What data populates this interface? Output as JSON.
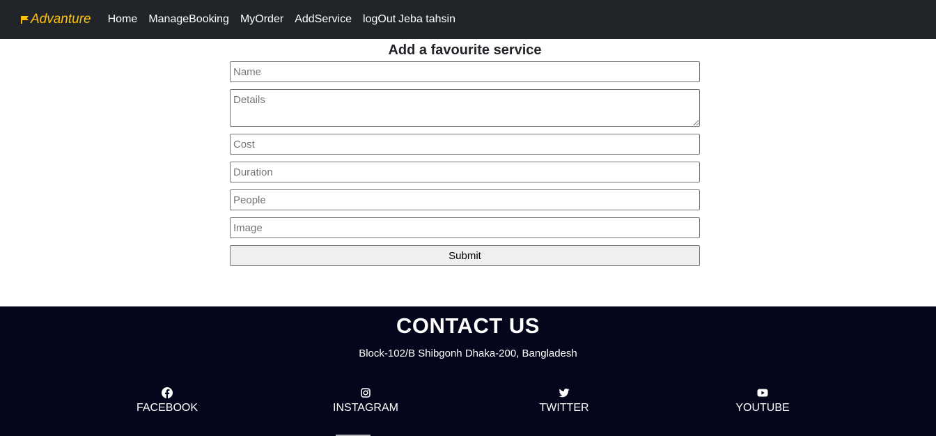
{
  "navbar": {
    "brand": "Advanture",
    "brand_color": "#ffc107",
    "background": "#212529",
    "links": [
      {
        "label": "Home"
      },
      {
        "label": "ManageBooking"
      },
      {
        "label": "MyOrder"
      },
      {
        "label": "AddService"
      },
      {
        "label": "logOut"
      }
    ],
    "user_name": "Jeba tahsin"
  },
  "form": {
    "title": "Add a favourite service",
    "fields": {
      "name": {
        "placeholder": "Name",
        "value": ""
      },
      "details": {
        "placeholder": "Details",
        "value": ""
      },
      "cost": {
        "placeholder": "Cost",
        "value": ""
      },
      "duration": {
        "placeholder": "Duration",
        "value": ""
      },
      "people": {
        "placeholder": "People",
        "value": ""
      },
      "image": {
        "placeholder": "Image",
        "value": ""
      }
    },
    "submit_label": "Submit"
  },
  "footer": {
    "background": "#05061b",
    "title": "CONTACT US",
    "address": "Block-102/B Shibgonh Dhaka-200, Bangladesh",
    "social": [
      {
        "label": "FACEBOOK",
        "icon": "facebook-icon"
      },
      {
        "label": "INSTAGRAM",
        "icon": "instagram-icon"
      },
      {
        "label": "TWITTER",
        "icon": "twitter-icon"
      },
      {
        "label": "YOUTUBE",
        "icon": "youtube-icon"
      }
    ]
  }
}
